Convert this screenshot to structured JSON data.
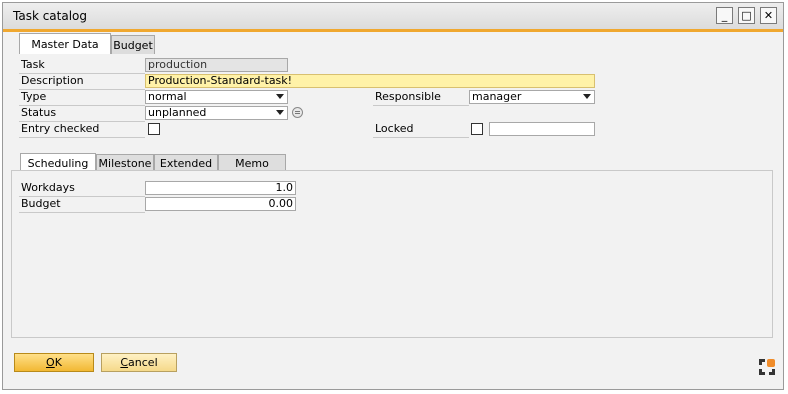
{
  "window": {
    "title": "Task catalog",
    "controls": {
      "minimize": "_",
      "maximize": "□",
      "close": "✕"
    }
  },
  "top_tabs": [
    {
      "label": "Master Data",
      "active": true
    },
    {
      "label": "Budget",
      "active": false
    }
  ],
  "master": {
    "task_label": "Task",
    "task_value": "production",
    "description_label": "Description",
    "description_value": "Production-Standard-task!",
    "type_label": "Type",
    "type_value": "normal",
    "status_label": "Status",
    "status_value": "unplanned",
    "entry_checked_label": "Entry checked",
    "entry_checked": false,
    "responsible_label": "Responsible",
    "responsible_value": "manager",
    "locked_label": "Locked",
    "locked": false,
    "locked_text": ""
  },
  "sub_tabs": [
    {
      "label": "Scheduling",
      "active": true
    },
    {
      "label": "Milestone",
      "active": false
    },
    {
      "label": "Extended",
      "active": false
    },
    {
      "label": "Memo",
      "active": false
    }
  ],
  "scheduling": {
    "workdays_label": "Workdays",
    "workdays_value": "1.0",
    "budget_label": "Budget",
    "budget_value": "0.00"
  },
  "buttons": {
    "ok_label": "OK",
    "ok_mnemonic": "O",
    "ok_rest": "K",
    "cancel_label": "Cancel",
    "cancel_mnemonic": "C",
    "cancel_rest": "ancel"
  },
  "colors": {
    "accent_line": "#f0a830",
    "highlight_field": "#fff2a8",
    "ok_button": "#f2b833"
  }
}
